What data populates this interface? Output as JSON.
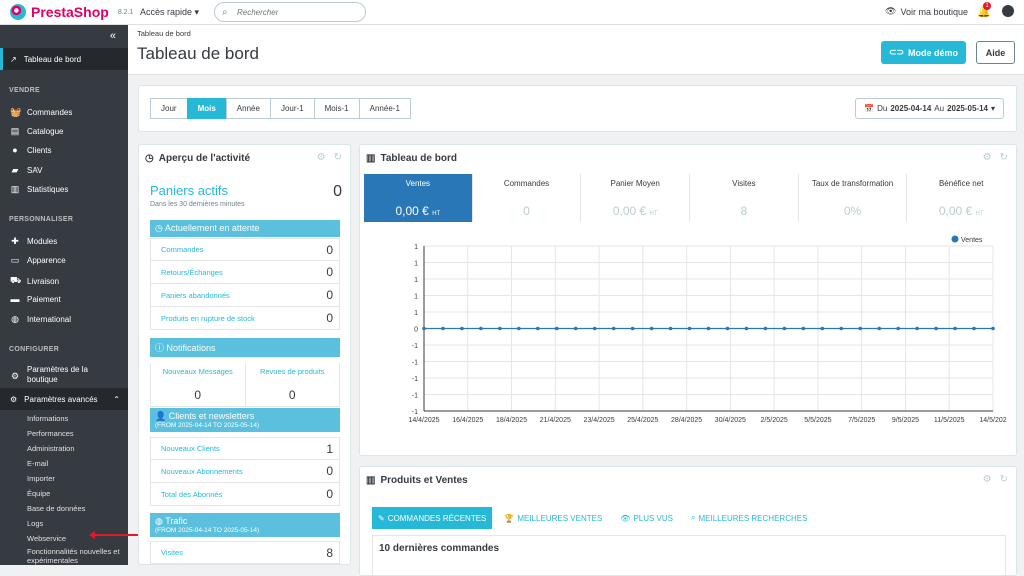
{
  "top": {
    "brand": "PrestaShop",
    "version": "8.2.1",
    "quick_access": "Accès rapide",
    "search_placeholder": "Rechercher",
    "view_shop": "Voir ma boutique",
    "notif_count": "1"
  },
  "sidebar": {
    "dashboard": "Tableau de bord",
    "sections": [
      "VENDRE",
      "PERSONNALISER",
      "CONFIGURER"
    ],
    "sell": [
      "Commandes",
      "Catalogue",
      "Clients",
      "SAV",
      "Statistiques"
    ],
    "customize": [
      "Modules",
      "Apparence",
      "Livraison",
      "Paiement",
      "International"
    ],
    "configure": [
      "Paramètres de la boutique",
      "Paramètres avancés"
    ],
    "advanced_sub": [
      "Informations",
      "Performances",
      "Administration",
      "E-mail",
      "Importer",
      "Équipe",
      "Base de données",
      "Logs",
      "Webservice",
      "Fonctionnalités nouvelles et expérimentales"
    ]
  },
  "header": {
    "breadcrumb": "Tableau de bord",
    "title": "Tableau de bord",
    "demo_button": "Mode démo",
    "help_button": "Aide"
  },
  "filters": {
    "periods": [
      "Jour",
      "Mois",
      "Année",
      "Jour-1",
      "Mois-1",
      "Année-1"
    ],
    "active_period": "Mois",
    "date_prefix": "Du",
    "date_from": "2025-04-14",
    "date_mid": "Au",
    "date_to": "2025-05-14"
  },
  "activity": {
    "title": "Aperçu de l'activité",
    "active_carts_label": "Paniers actifs",
    "active_carts_sub": "Dans les 30 dernières minutes",
    "active_carts_value": "0",
    "pending_title": "Actuellement en attente",
    "pending": [
      {
        "label": "Commandes",
        "value": "0"
      },
      {
        "label": "Retours/Échanges",
        "value": "0"
      },
      {
        "label": "Paniers abandonnés",
        "value": "0"
      },
      {
        "label": "Produits en rupture de stock",
        "value": "0"
      }
    ],
    "notifications_title": "Notifications",
    "notifications": [
      {
        "label": "Nouveaux Messages",
        "value": "0"
      },
      {
        "label": "Revues de produits",
        "value": "0"
      }
    ],
    "clients_title": "Clients et newsletters",
    "clients_sub": "(FROM 2025-04-14 TO 2025-05-14)",
    "clients": [
      {
        "label": "Nouveaux Clients",
        "value": "1"
      },
      {
        "label": "Nouveaux Abonnements",
        "value": "0"
      },
      {
        "label": "Total des Abonnés",
        "value": "0"
      }
    ],
    "traffic_title": "Trafic",
    "traffic_sub": "(FROM 2025-04-14 TO 2025-05-14)",
    "traffic": [
      {
        "label": "Visites",
        "value": "8"
      }
    ]
  },
  "dashboard_panel": {
    "title": "Tableau de bord",
    "kpis": [
      {
        "label": "Ventes",
        "value": "0,00 €",
        "unit": "HT"
      },
      {
        "label": "Commandes",
        "value": "0",
        "unit": ""
      },
      {
        "label": "Panier Moyen",
        "value": "0,00 €",
        "unit": "HT"
      },
      {
        "label": "Visites",
        "value": "8",
        "unit": ""
      },
      {
        "label": "Taux de transformation",
        "value": "0%",
        "unit": ""
      },
      {
        "label": "Bénéfice net",
        "value": "0,00 €",
        "unit": "HT"
      }
    ]
  },
  "chart_data": {
    "type": "line",
    "x_tick_labels": [
      "14/4/2025",
      "16/4/2025",
      "18/4/2025",
      "21/4/2025",
      "23/4/2025",
      "25/4/2025",
      "28/4/2025",
      "30/4/2025",
      "2/5/2025",
      "5/5/2025",
      "7/5/2025",
      "9/5/2025",
      "11/5/2025",
      "14/5/202"
    ],
    "y_tick_labels": [
      "1",
      "1",
      "1",
      "1",
      "1",
      "0",
      "-1",
      "-1",
      "-1",
      "-1",
      "-1"
    ],
    "series": [
      {
        "name": "Ventes",
        "x": [
          "14/4/2025",
          "15/4/2025",
          "16/4/2025",
          "17/4/2025",
          "18/4/2025",
          "19/4/2025",
          "20/4/2025",
          "21/4/2025",
          "22/4/2025",
          "23/4/2025",
          "24/4/2025",
          "25/4/2025",
          "26/4/2025",
          "27/4/2025",
          "28/4/2025",
          "29/4/2025",
          "30/4/2025",
          "1/5/2025",
          "2/5/2025",
          "3/5/2025",
          "4/5/2025",
          "5/5/2025",
          "6/5/2025",
          "7/5/2025",
          "8/5/2025",
          "9/5/2025",
          "10/5/2025",
          "11/5/2025",
          "12/5/2025",
          "13/5/2025",
          "14/5/2025"
        ],
        "values": [
          0,
          0,
          0,
          0,
          0,
          0,
          0,
          0,
          0,
          0,
          0,
          0,
          0,
          0,
          0,
          0,
          0,
          0,
          0,
          0,
          0,
          0,
          0,
          0,
          0,
          0,
          0,
          0,
          0,
          0,
          0
        ],
        "color": "#2a77b8"
      }
    ],
    "legend": "top-right",
    "grid": true
  },
  "products_panel": {
    "title": "Produits et Ventes",
    "tabs": [
      "COMMANDES RÉCENTES",
      "MEILLEURES VENTES",
      "PLUS VUS",
      "MEILLEURES RECHERCHES"
    ],
    "recent_title": "10 dernières commandes"
  }
}
